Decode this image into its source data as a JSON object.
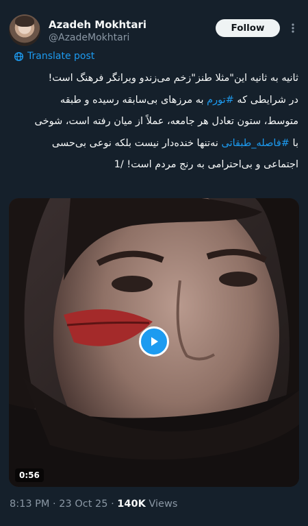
{
  "author": {
    "name": "Azadeh Mokhtari",
    "handle": "@AzadeMokhtari",
    "follow_label": "Follow"
  },
  "translate_label": "Translate post",
  "tweet": {
    "line1": "ثانیه به ثانیه این\"مثلا طنز\"زخم می‌زندو ویرانگر فرهنگ است!",
    "line2_pre": "در شرایطی که ",
    "hashtag1": "#تورم",
    "line2_post": " به مرزهای بی‌سابقه رسیده و طبقه",
    "line3": "متوسط، ستون تعادل هر جامعه، عملاً از میان رفته است، شوخی",
    "line4_pre": "با ",
    "hashtag2": "#فاصله_طبقاتی",
    "line4_post": " نه‌تنها خنده‌دار نیست بلکه نوعی بی‌حسی",
    "line5": "اجتماعی و بی‌احترامی به رنج مردم است! /1"
  },
  "video": {
    "duration": "0:56"
  },
  "meta": {
    "time": "8:13 PM",
    "separator": " · ",
    "date": "23 Oct 25",
    "views_count": "140K",
    "views_label": " Views"
  },
  "colors": {
    "background": "#15202b",
    "accent": "#1d9bf0",
    "text": "#f7f9f9",
    "secondary": "#8b98a5"
  },
  "icons": [
    "more-icon",
    "globe-icon",
    "play-icon"
  ]
}
